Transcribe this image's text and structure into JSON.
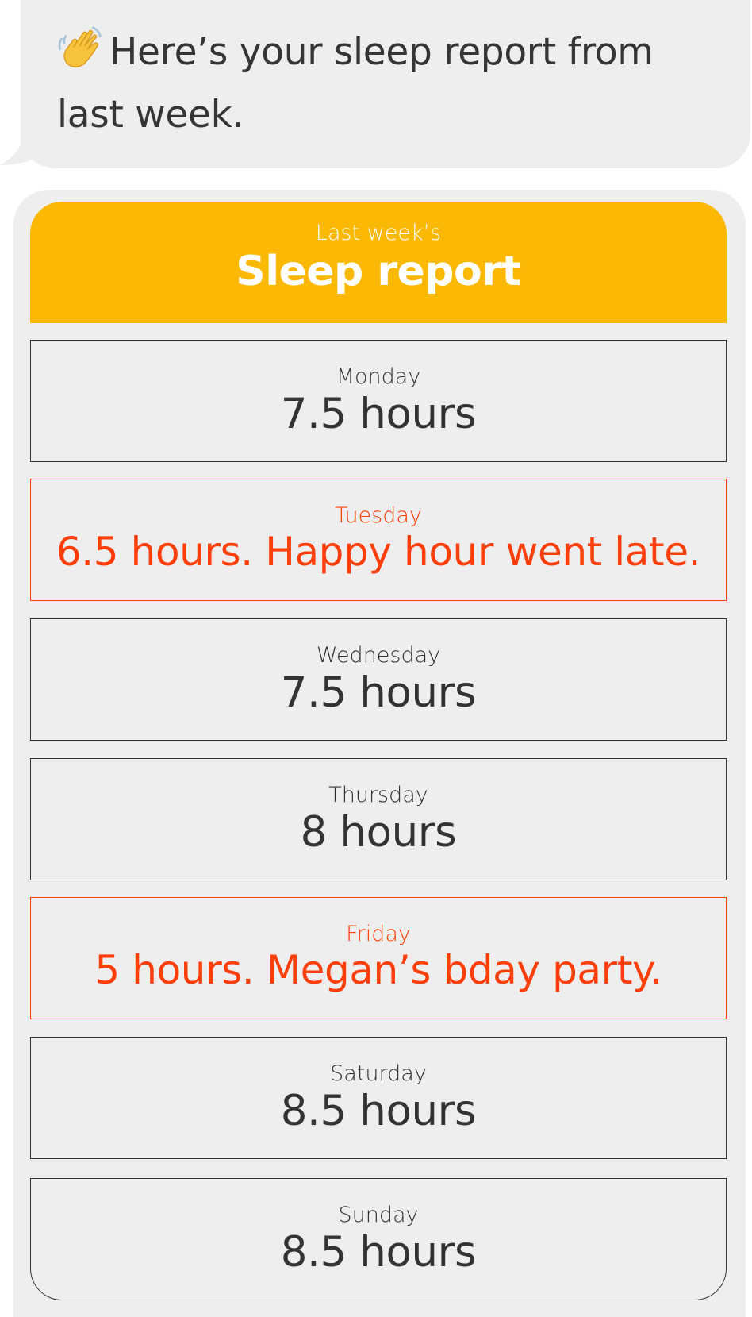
{
  "message": {
    "icon": "waving-hand-icon",
    "text": "Here’s your sleep report from last week."
  },
  "report": {
    "subtitle": "Last week’s",
    "title": "Sleep report",
    "colors": {
      "header": "#fbb905",
      "alert": "#fe3f0a",
      "text": "#333333",
      "background": "#eeeeee"
    },
    "days": [
      {
        "day": "Monday",
        "value": "7.5 hours",
        "alert": false
      },
      {
        "day": "Tuesday",
        "value": "6.5 hours. Happy hour went late.",
        "alert": true
      },
      {
        "day": "Wednesday",
        "value": "7.5 hours",
        "alert": false
      },
      {
        "day": "Thursday",
        "value": "8 hours",
        "alert": false
      },
      {
        "day": "Friday",
        "value": "5 hours. Megan’s bday party.",
        "alert": true
      },
      {
        "day": "Saturday",
        "value": "8.5 hours",
        "alert": false
      },
      {
        "day": "Sunday",
        "value": "8.5 hours",
        "alert": false
      }
    ]
  }
}
